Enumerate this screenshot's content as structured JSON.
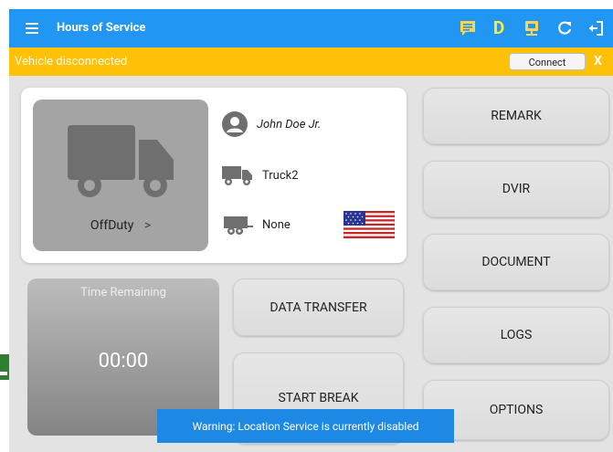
{
  "app": {
    "title": "Hours of Service",
    "theme_color": "#2196f3"
  },
  "appbar": {
    "icons": [
      "menu-icon",
      "message-icon",
      "d-letter",
      "device-icon",
      "refresh-icon",
      "logout-icon"
    ],
    "d_label": "D"
  },
  "banner": {
    "text": "Vehicle disconnected",
    "connect_label": "Connect",
    "close_label": "X",
    "color": "#ffc107"
  },
  "driver": {
    "status": "OffDuty",
    "status_chevron": ">",
    "name": "John Doe Jr.",
    "vehicle": "Truck2",
    "trailer": "None"
  },
  "time_remaining": {
    "label": "Time Remaining",
    "value": "00:00"
  },
  "buttons": {
    "data_transfer": "DATA TRANSFER",
    "start_break": "START BREAK",
    "remark": "REMARK",
    "dvir": "DVIR",
    "document": "DOCUMENT",
    "logs": "LOGS",
    "options": "OPTIONS"
  },
  "toast": {
    "text": "Warning: Location Service is currently disabled"
  }
}
